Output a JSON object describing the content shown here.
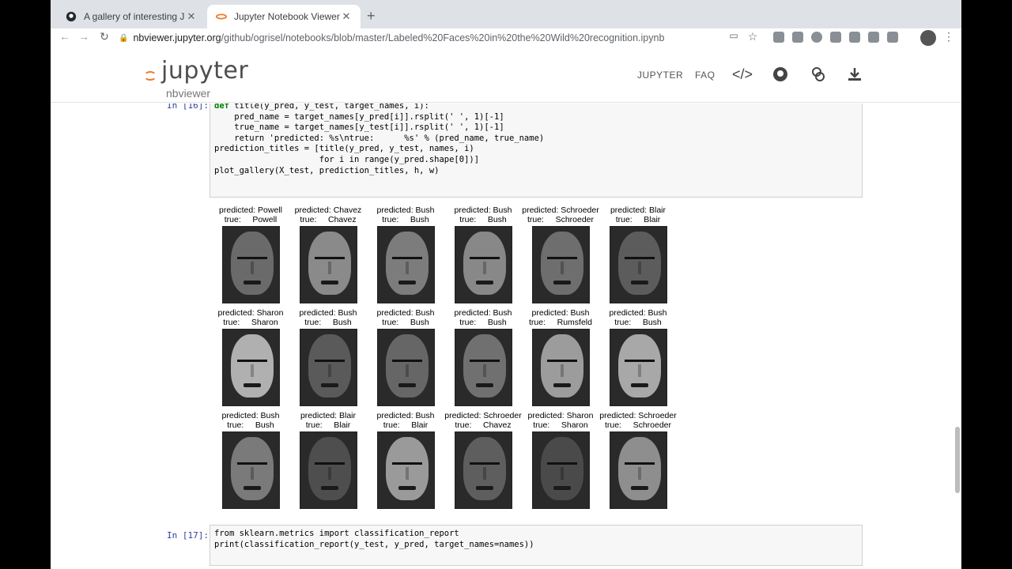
{
  "browser": {
    "tabs": [
      {
        "title": "A gallery of interesting Jupyter",
        "close": "✕"
      },
      {
        "title": "Jupyter Notebook Viewer",
        "close": "✕"
      }
    ],
    "new_tab": "+",
    "url_host": "nbviewer.jupyter.org",
    "url_path": "/github/ogrisel/notebooks/blob/master/Labeled%20Faces%20in%20the%20Wild%20recognition.ipynb"
  },
  "header": {
    "logo_text": "jupyter",
    "logo_sub": "nbviewer",
    "nav": {
      "jupyter": "JUPYTER",
      "faq": "FAQ"
    },
    "icons": [
      "code-icon",
      "github-icon",
      "binder-icon",
      "download-icon"
    ]
  },
  "cells": {
    "cell16": {
      "prompt": "In [16]:",
      "lines": [
        "def title(y_pred, y_test, target_names, i):",
        "    pred_name = target_names[y_pred[i]].rsplit(' ', 1)[-1]",
        "    true_name = target_names[y_test[i]].rsplit(' ', 1)[-1]",
        "    return 'predicted: %s\\ntrue:      %s' % (pred_name, true_name)",
        "",
        "prediction_titles = [title(y_pred, y_test, names, i)",
        "                     for i in range(y_pred.shape[0])]",
        "",
        "plot_gallery(X_test, prediction_titles, h, w)"
      ]
    },
    "cell17": {
      "prompt": "In [17]:",
      "lines": [
        "from sklearn.metrics import classification_report",
        "",
        "print(classification_report(y_test, y_pred, target_names=names))"
      ]
    }
  },
  "gallery": [
    [
      {
        "pred": "predicted: Powell",
        "true": "true:     Powell",
        "tone": "#6a6a6a"
      },
      {
        "pred": "predicted: Chavez",
        "true": "true:     Chavez",
        "tone": "#8a8a8a"
      },
      {
        "pred": "predicted: Bush",
        "true": "true:     Bush",
        "tone": "#7c7c7c"
      },
      {
        "pred": "predicted: Bush",
        "true": "true:     Bush",
        "tone": "#888888"
      },
      {
        "pred": "predicted: Schroeder",
        "true": "true:     Schroeder",
        "tone": "#6e6e6e"
      },
      {
        "pred": "predicted: Blair",
        "true": "true:     Blair",
        "tone": "#5c5c5c"
      }
    ],
    [
      {
        "pred": "predicted: Sharon",
        "true": "true:     Sharon",
        "tone": "#b0b0b0"
      },
      {
        "pred": "predicted: Bush",
        "true": "true:     Bush",
        "tone": "#5a5a5a"
      },
      {
        "pred": "predicted: Bush",
        "true": "true:     Bush",
        "tone": "#666666"
      },
      {
        "pred": "predicted: Bush",
        "true": "true:     Bush",
        "tone": "#707070"
      },
      {
        "pred": "predicted: Bush",
        "true": "true:     Rumsfeld",
        "tone": "#9c9c9c"
      },
      {
        "pred": "predicted: Bush",
        "true": "true:     Bush",
        "tone": "#a8a8a8"
      }
    ],
    [
      {
        "pred": "predicted: Bush",
        "true": "true:     Bush",
        "tone": "#7a7a7a"
      },
      {
        "pred": "predicted: Blair",
        "true": "true:     Blair",
        "tone": "#4e4e4e"
      },
      {
        "pred": "predicted: Bush",
        "true": "true:     Blair",
        "tone": "#9a9a9a"
      },
      {
        "pred": "predicted: Schroeder",
        "true": "true:     Chavez",
        "tone": "#5e5e5e"
      },
      {
        "pred": "predicted: Sharon",
        "true": "true:     Sharon",
        "tone": "#4a4a4a"
      },
      {
        "pred": "predicted: Schroeder",
        "true": "true:     Schroeder",
        "tone": "#8e8e8e"
      }
    ]
  ]
}
